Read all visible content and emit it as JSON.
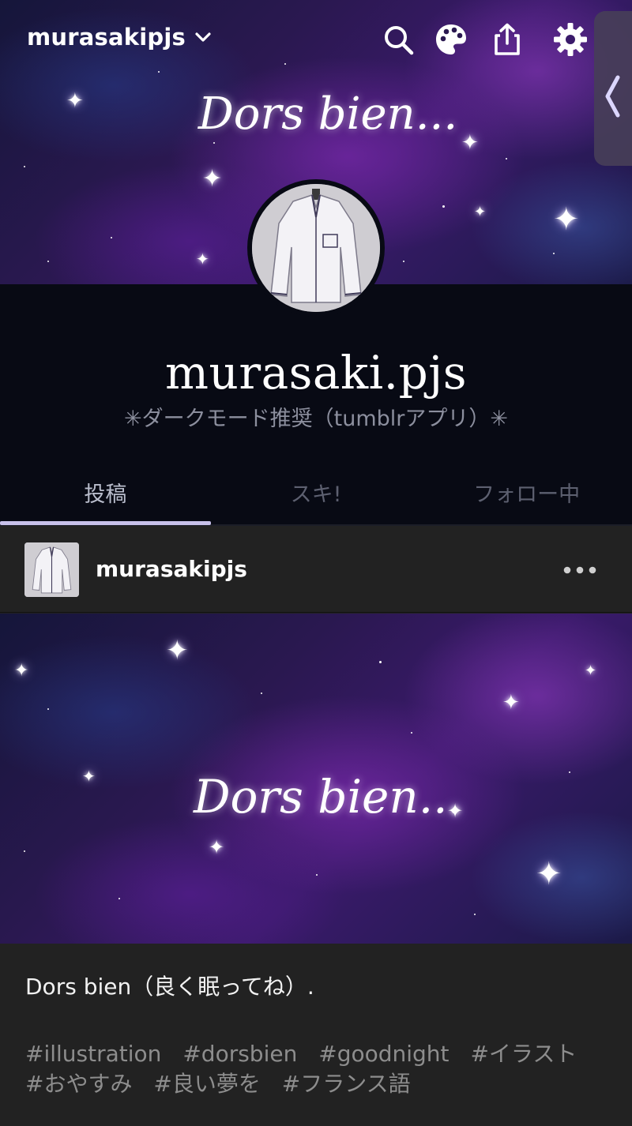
{
  "header": {
    "blog_switch_label": "murasakipjs",
    "banner_text": "Dors bien...",
    "icons": [
      "search-icon",
      "palette-icon",
      "share-icon",
      "gear-icon",
      "chevron-down-icon",
      "chevron-left-icon"
    ]
  },
  "profile": {
    "title": "murasaki.pjs",
    "description": "✳︎ダークモード推奨（tumblrアプリ）✳︎",
    "avatar_icon": "pajama-shirt-avatar"
  },
  "tabs": [
    {
      "label": "投稿",
      "active": true
    },
    {
      "label": "スキ!",
      "active": false
    },
    {
      "label": "フォロー中",
      "active": false
    }
  ],
  "post": {
    "author": "murasakipjs",
    "image_text": "Dors bien...",
    "caption": "Dors bien（良く眠ってね）.",
    "tags": [
      "#illustration",
      "#dorsbien",
      "#goodnight",
      "#イラスト",
      "#おやすみ",
      "#良い夢を",
      "#フランス語"
    ]
  },
  "colors": {
    "page_bg": "#080a14",
    "post_bg": "#222222",
    "tab_accent": "#c7c0ea",
    "muted_text": "#8c8f9e"
  }
}
